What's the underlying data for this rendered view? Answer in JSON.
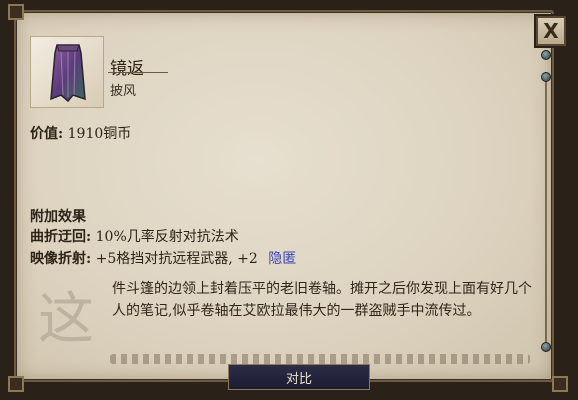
{
  "item": {
    "name": "镜返",
    "type": "披风",
    "icon": "cloak-icon"
  },
  "value": {
    "label": "价值:",
    "amount": "1910铜币"
  },
  "effects": {
    "title": "附加效果",
    "rows": [
      {
        "label": "曲折迂回:",
        "text": "10%几率反射对抗法术",
        "tag": ""
      },
      {
        "label": "映像折射:",
        "text": "+5格挡对抗远程武器, +2",
        "tag": "隐匿"
      }
    ]
  },
  "description": {
    "drop_cap": "这",
    "text": "件斗篷的边领上封着压平的老旧卷轴。摊开之后你发现上面有好几个人的笔记,似乎卷轴在艾欧拉最伟大的一群盗贼手中流传过。"
  },
  "buttons": {
    "close": "X",
    "compare": "对比"
  },
  "colors": {
    "parchment": "#e2d9c6",
    "keyword_link": "#3a46b6",
    "frame": "#2a2118"
  }
}
